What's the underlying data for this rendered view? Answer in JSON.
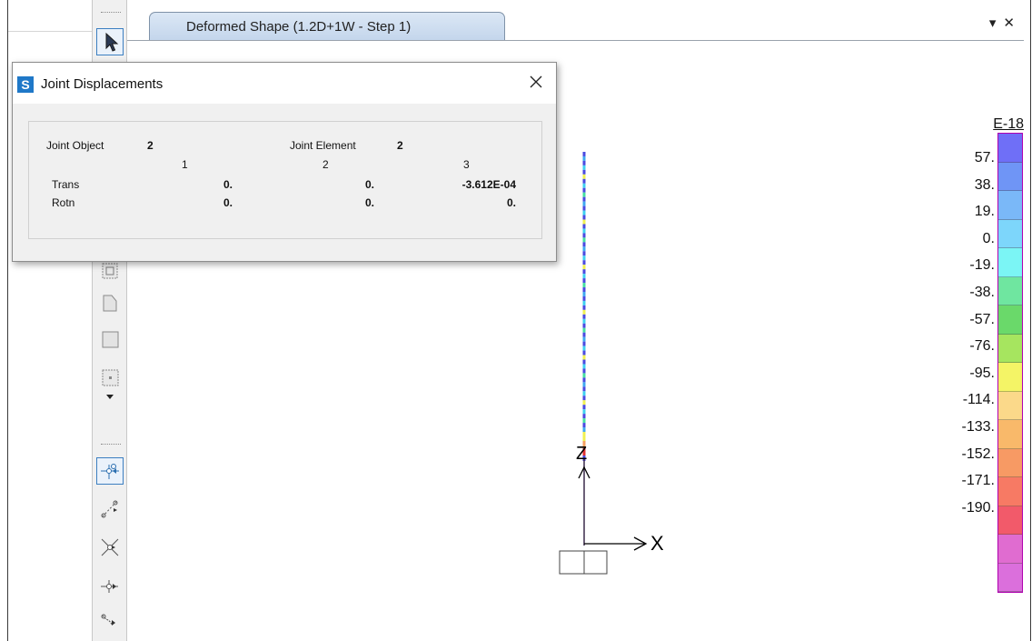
{
  "tab": {
    "title": "Deformed Shape (1.2D+1W - Step 1)",
    "dropdown_glyph": "▾",
    "close_glyph": "✕"
  },
  "dialog": {
    "logo": "S",
    "title": "Joint Displacements",
    "joint_object_label": "Joint  Object",
    "joint_object_value": "2",
    "joint_element_label": "Joint Element",
    "joint_element_value": "2",
    "columns": [
      "1",
      "2",
      "3"
    ],
    "rows": [
      {
        "label": "Trans",
        "values": [
          "0.",
          "0.",
          "-3.612E-04"
        ]
      },
      {
        "label": "Rotn",
        "values": [
          "0.",
          "0.",
          "0."
        ]
      }
    ]
  },
  "axes": {
    "z": "Z",
    "x": "X"
  },
  "legend": {
    "exponent": "E-18",
    "labels": [
      "57.",
      "38.",
      "19.",
      "0.",
      "-19.",
      "-38.",
      "-57.",
      "-76.",
      "-95.",
      "-114.",
      "-133.",
      "-152.",
      "-171.",
      "-190."
    ],
    "colors": [
      "#6f6ff7",
      "#6f95f6",
      "#7ab8f8",
      "#7dd6fb",
      "#7bf5f5",
      "#6fe6a0",
      "#6ad96a",
      "#a6e55f",
      "#f4f466",
      "#fbd98a",
      "#f9b96a",
      "#f79a64",
      "#f77a64",
      "#f25a6a",
      "#e06cd0",
      "#db6fdc"
    ]
  },
  "toolbar": {
    "tools": [
      "pointer-tool",
      "frame-section-tool",
      "area-tool",
      "shell-tool",
      "solid-tool",
      "dropdown-arrow",
      "joint-tool",
      "link-tool",
      "cross-tool",
      "restraint-tool",
      "spring-tool"
    ]
  }
}
